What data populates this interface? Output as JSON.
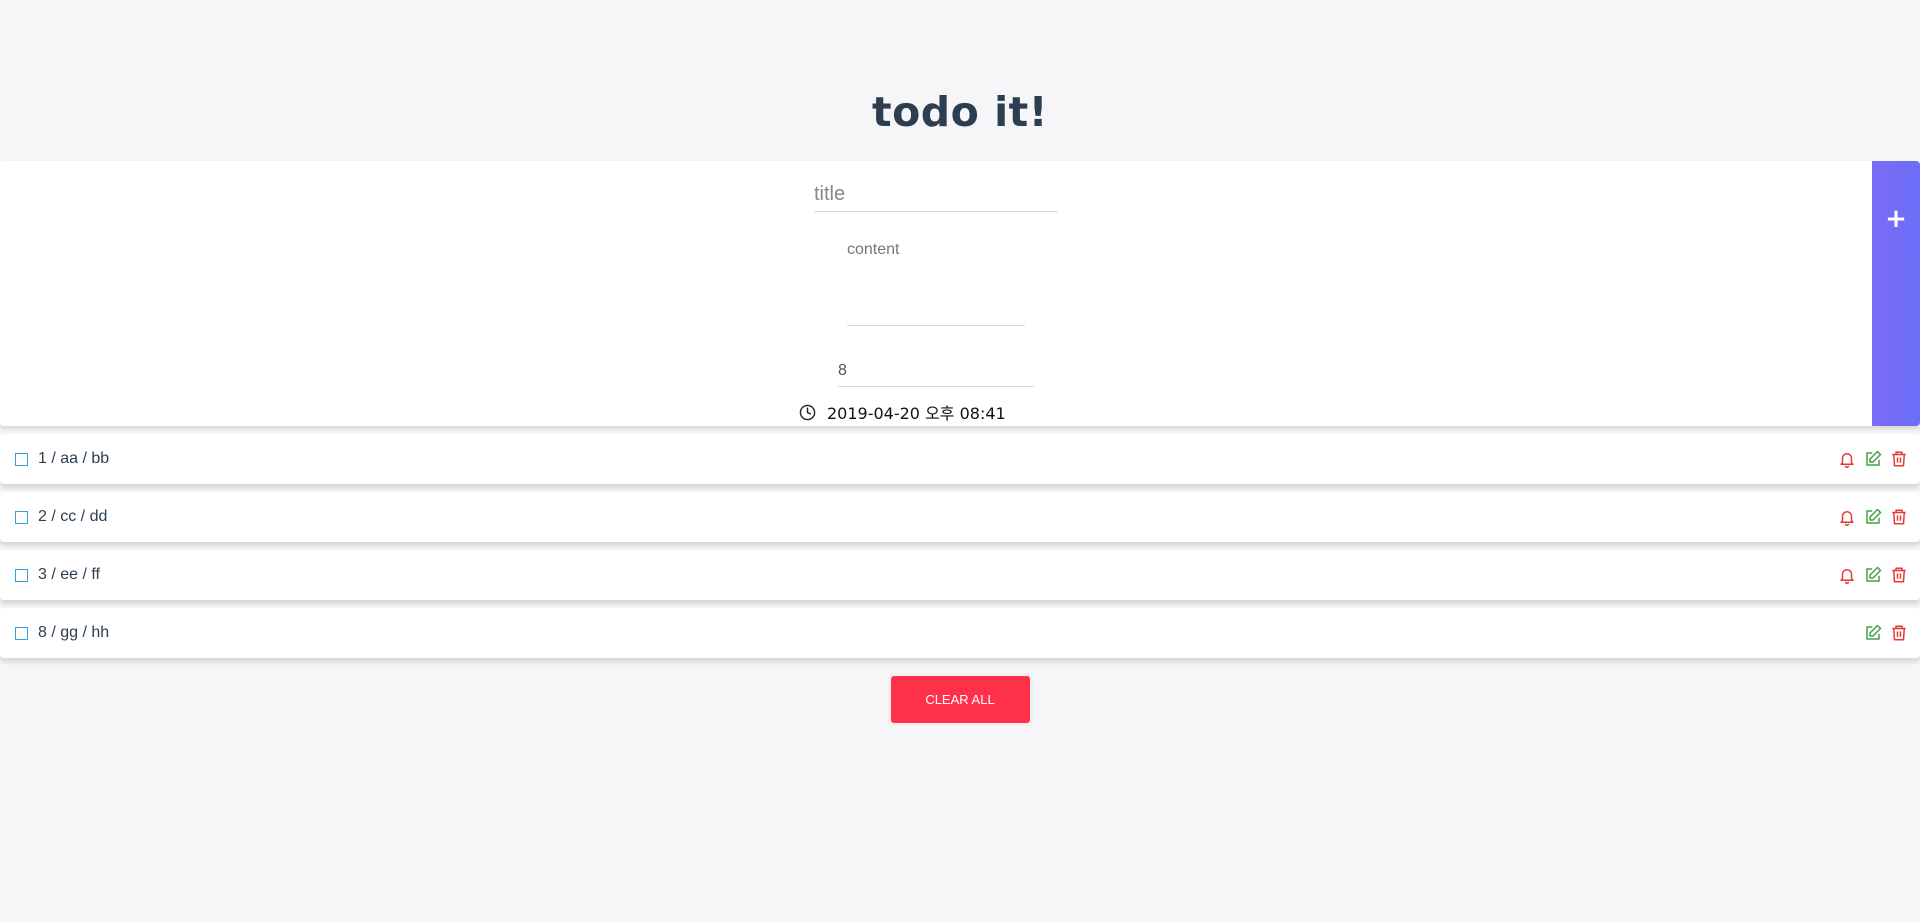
{
  "header": {
    "title": "todo it!"
  },
  "form": {
    "title_placeholder": "title",
    "content_placeholder": "content",
    "priority_value": "8",
    "datetime": "2019-04-20 오후 08:41",
    "add_label": "+"
  },
  "todos": [
    {
      "text": "1 / aa / bb",
      "has_alarm": true
    },
    {
      "text": "2 / cc / dd",
      "has_alarm": true
    },
    {
      "text": "3 / ee / ff",
      "has_alarm": true
    },
    {
      "text": "8 / gg / hh",
      "has_alarm": false
    }
  ],
  "footer": {
    "clear_label": "CLEAR ALL"
  },
  "colors": {
    "accent": "#7b6cf6",
    "danger": "#ff3049",
    "checkbox": "#3a9fe0",
    "alarm_icon": "#e53935",
    "edit_icon": "#43a047",
    "delete_icon": "#e53935"
  },
  "icons": {
    "clock": "clock-icon",
    "checkbox": "checkbox-icon",
    "alarm": "bell-icon",
    "edit": "edit-icon",
    "delete": "trash-icon",
    "add": "plus-icon"
  }
}
